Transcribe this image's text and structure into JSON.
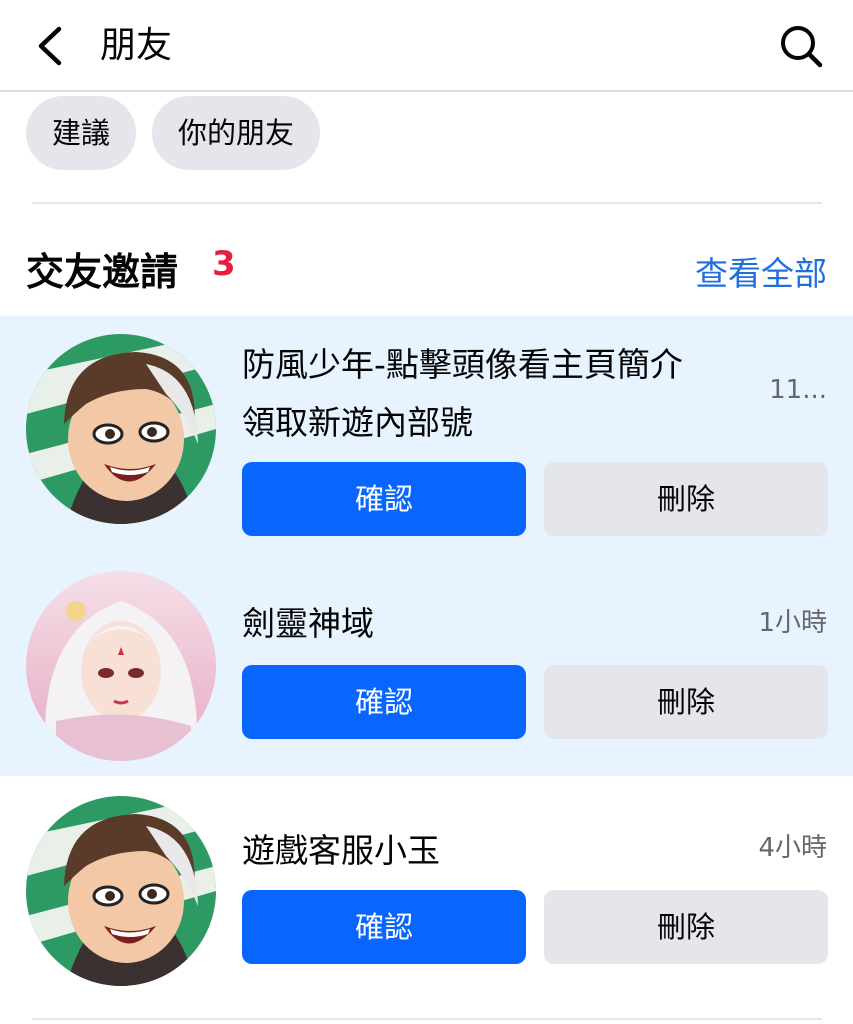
{
  "header": {
    "title": "朋友",
    "back_icon": "chevron-left-icon",
    "search_icon": "search-icon"
  },
  "chips": [
    {
      "label": "建議"
    },
    {
      "label": "你的朋友"
    }
  ],
  "section": {
    "title": "交友邀請",
    "count": "3",
    "see_all": "查看全部"
  },
  "requests": [
    {
      "name_line1": "防風少年-點擊頭像看主頁簡介",
      "name_line2": "領取新遊內部號",
      "time": "11...",
      "confirm": "確認",
      "delete": "刪除",
      "avatar": "anime-boy-avatar",
      "unread": true
    },
    {
      "name_line1": "劍靈神域",
      "time": "1小時",
      "confirm": "確認",
      "delete": "刪除",
      "avatar": "anime-girl-avatar",
      "avatar_caption": "劍靈神域",
      "unread": true
    },
    {
      "name_line1": "遊戲客服小玉",
      "time": "4小時",
      "confirm": "確認",
      "delete": "刪除",
      "avatar": "anime-boy-avatar",
      "unread": false
    }
  ],
  "colors": {
    "accent": "#0866ff",
    "link": "#216fdb",
    "badge": "#e41e3f",
    "unread_bg": "#e7f3ff",
    "chip_bg": "#e4e6eb"
  }
}
